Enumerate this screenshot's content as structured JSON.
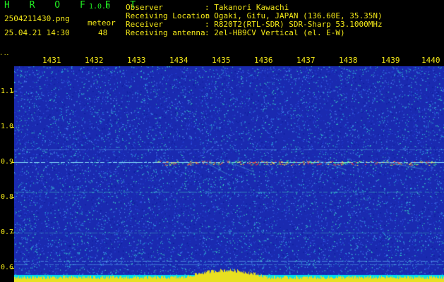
{
  "header": {
    "app_title": "H R O F F T",
    "version": "1.0.0",
    "filename": "2504211430.png",
    "datetime": "25.04.21 14:30",
    "meteor_label": "meteor",
    "meteor_count": "48",
    "info": [
      {
        "label": "Observer",
        "value": ": Takanori Kawachi"
      },
      {
        "label": "Receiving Location",
        "value": ": Ogaki, Gifu, JAPAN (136.60E, 35.35N)"
      },
      {
        "label": "Receiver",
        "value": ": R820T2(RTL-SDR) SDR-Sharp 53.1000MHz"
      },
      {
        "label": "Receiving antenna",
        "value": ": 2el-HB9CV Vertical (el. E-W)"
      }
    ]
  },
  "axis": {
    "y_unit": "kHz",
    "time_ticks": [
      "1431",
      "1432",
      "1433",
      "1434",
      "1435",
      "1436",
      "1437",
      "1438",
      "1439",
      "1440"
    ],
    "freq_ticks": [
      "1.1",
      "1.0",
      "0.9",
      "0.8",
      "0.7",
      "0.6"
    ]
  },
  "colors": {
    "label_yellow": "#f3e818",
    "title_green": "#22ee22",
    "background_blue": "#1a2ab0"
  }
}
